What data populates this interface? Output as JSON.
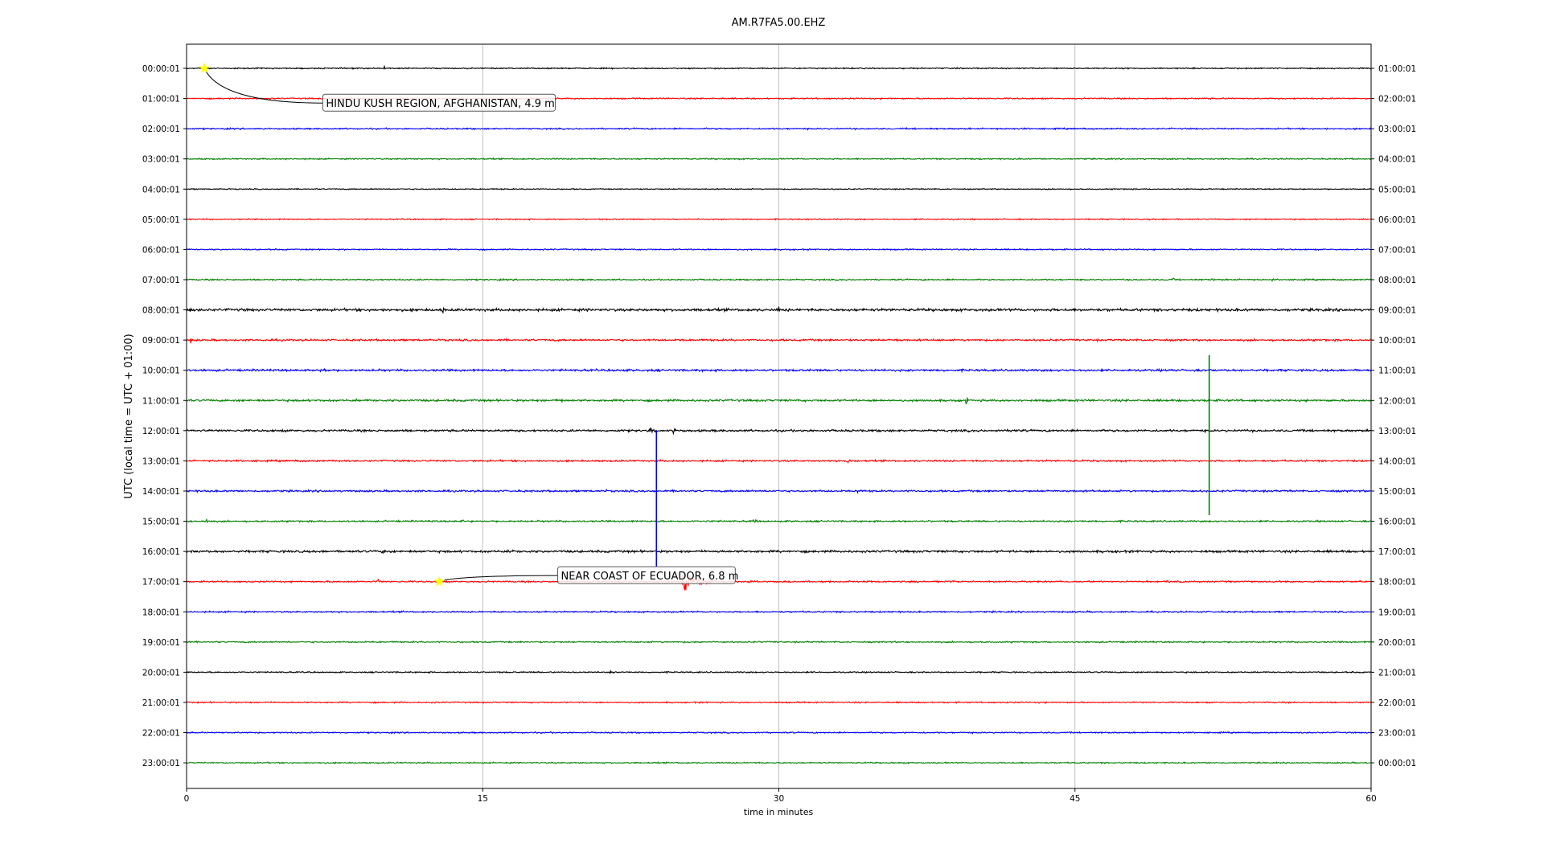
{
  "chart_data": {
    "type": "line",
    "title": "AM.R7FA5.00.EHZ",
    "xlabel": "time in minutes",
    "ylabel": "UTC (local time = UTC + 01:00)",
    "xlim": [
      0,
      60
    ],
    "xticks": [
      0,
      15,
      30,
      45,
      60
    ],
    "grid": "vertical",
    "row_colors": [
      "#000000",
      "#ff0000",
      "#0000ff",
      "#008000"
    ],
    "rows": [
      {
        "left": "00:00:01",
        "right": "01:00:01",
        "noise": 1.0,
        "bursts": [
          [
            10.0,
            9,
            0.03
          ]
        ]
      },
      {
        "left": "01:00:01",
        "right": "02:00:01",
        "noise": 1.1,
        "bursts": []
      },
      {
        "left": "02:00:01",
        "right": "03:00:01",
        "noise": 1.2,
        "bursts": []
      },
      {
        "left": "03:00:01",
        "right": "04:00:01",
        "noise": 1.1,
        "bursts": []
      },
      {
        "left": "04:00:01",
        "right": "05:00:01",
        "noise": 0.9,
        "bursts": []
      },
      {
        "left": "05:00:01",
        "right": "06:00:01",
        "noise": 1.0,
        "bursts": []
      },
      {
        "left": "06:00:01",
        "right": "07:00:01",
        "noise": 1.1,
        "bursts": []
      },
      {
        "left": "07:00:01",
        "right": "08:00:01",
        "noise": 1.2,
        "bursts": [
          [
            50.0,
            4,
            0.05
          ],
          [
            52.0,
            5,
            0.05
          ],
          [
            55.0,
            3,
            0.05
          ]
        ]
      },
      {
        "left": "08:00:01",
        "right": "09:00:01",
        "noise": 2.2,
        "bursts": [
          [
            13.0,
            8,
            0.05
          ],
          [
            23.0,
            5,
            0.05
          ],
          [
            30.0,
            6,
            0.05
          ],
          [
            0.2,
            6,
            0.05
          ]
        ]
      },
      {
        "left": "09:00:01",
        "right": "10:00:01",
        "noise": 1.6,
        "bursts": [
          [
            0.2,
            6,
            0.05
          ],
          [
            36.0,
            4,
            0.05
          ]
        ]
      },
      {
        "left": "10:00:01",
        "right": "11:00:01",
        "noise": 1.8,
        "bursts": [
          [
            7.0,
            6,
            0.05
          ],
          [
            22.0,
            6,
            0.05
          ],
          [
            50.0,
            6,
            0.05
          ]
        ]
      },
      {
        "left": "11:00:01",
        "right": "12:00:01",
        "noise": 1.8,
        "bursts": [
          [
            19.0,
            7,
            0.08
          ],
          [
            39.5,
            7,
            0.08
          ]
        ]
      },
      {
        "left": "12:00:01",
        "right": "13:00:01",
        "noise": 1.8,
        "bursts": [
          [
            23.5,
            7,
            0.08
          ],
          [
            24.7,
            10,
            0.05
          ],
          [
            42.0,
            8,
            0.05
          ]
        ]
      },
      {
        "left": "13:00:01",
        "right": "14:00:01",
        "noise": 1.5,
        "bursts": [
          [
            33.5,
            5,
            0.1
          ]
        ]
      },
      {
        "left": "14:00:01",
        "right": "15:00:01",
        "noise": 1.6,
        "bursts": [
          [
            21.2,
            8,
            0.04
          ],
          [
            34.0,
            6,
            0.05
          ]
        ]
      },
      {
        "left": "15:00:01",
        "right": "16:00:01",
        "noise": 1.4,
        "bursts": [
          [
            1.0,
            7,
            0.05
          ],
          [
            14.0,
            6,
            0.05
          ],
          [
            28.8,
            6,
            0.05
          ]
        ]
      },
      {
        "left": "16:00:01",
        "right": "17:00:01",
        "noise": 1.9,
        "bursts": [
          [
            10.0,
            5,
            0.1
          ],
          [
            16.5,
            7,
            0.05
          ]
        ]
      },
      {
        "left": "17:00:01",
        "right": "18:00:01",
        "noise": 1.3,
        "bursts": [
          [
            9.7,
            8,
            0.04
          ]
        ]
      },
      {
        "left": "18:00:01",
        "right": "19:00:01",
        "noise": 1.3,
        "bursts": []
      },
      {
        "left": "19:00:01",
        "right": "20:00:01",
        "noise": 1.2,
        "bursts": []
      },
      {
        "left": "20:00:01",
        "right": "21:00:01",
        "noise": 1.1,
        "bursts": [
          [
            21.5,
            4,
            0.05
          ]
        ]
      },
      {
        "left": "21:00:01",
        "right": "22:00:01",
        "noise": 1.1,
        "bursts": []
      },
      {
        "left": "22:00:01",
        "right": "23:00:01",
        "noise": 1.1,
        "bursts": []
      },
      {
        "left": "23:00:01",
        "right": "00:00:01",
        "noise": 1.1,
        "bursts": []
      }
    ],
    "spikes": [
      {
        "row": 10,
        "minute": 51.8,
        "color": "#008000",
        "from_row": 9.5,
        "to_row": 14.8
      },
      {
        "row": 14,
        "minute": 23.8,
        "color": "#0000ff",
        "from_row": 12.0,
        "to_row": 16.5
      }
    ],
    "quake_signal": {
      "row": 17,
      "start_minute": 25.1,
      "peak_rows": 0.72,
      "decay_minutes": 0.7,
      "color": "#ff0000"
    },
    "events": [
      {
        "label": "HINDU KUSH REGION, AFGHANISTAN, 4.9 m",
        "row": 0,
        "minute": 0.9,
        "label_minute": 6.9,
        "label_row": 1.15
      },
      {
        "label": "NEAR COAST OF ECUADOR, 6.8 m",
        "row": 17,
        "minute": 12.8,
        "label_minute": 18.8,
        "label_row": 16.8
      }
    ]
  }
}
